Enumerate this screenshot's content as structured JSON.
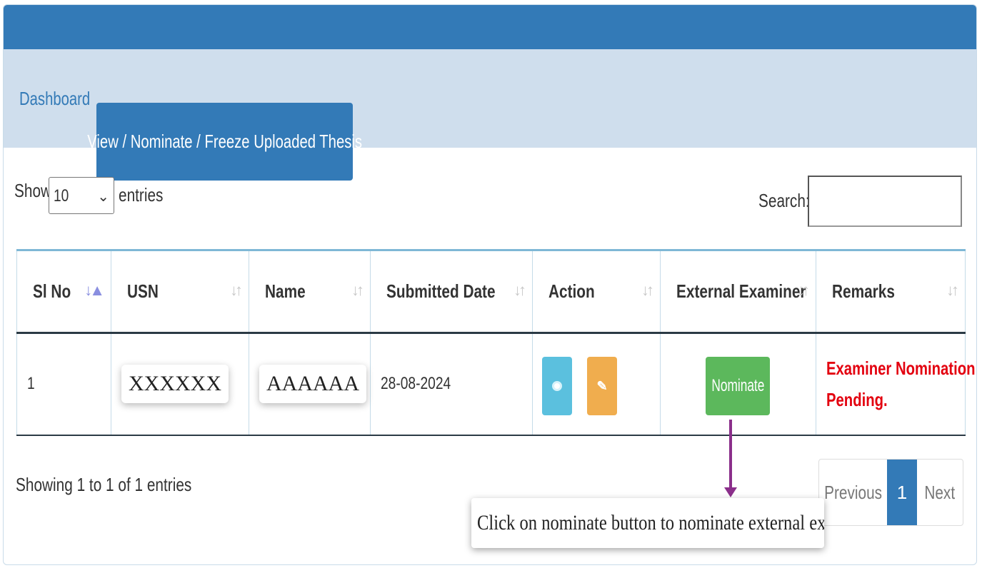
{
  "tabs": {
    "dashboard": "Dashboard",
    "active": "View / Nominate / Freeze Uploaded Thesis"
  },
  "length_menu": {
    "show_label": "Show",
    "selected": "10",
    "entries_label": "entries"
  },
  "search": {
    "label": "Search:",
    "value": ""
  },
  "table": {
    "columns": [
      "Sl No",
      "USN",
      "Name",
      "Submitted Date",
      "Action",
      "External Examiner",
      "Remarks"
    ],
    "rows": [
      {
        "sl_no": "1",
        "usn": "XXXXXX",
        "name": "AAAAAA",
        "submitted_date": "28-08-2024",
        "nominate_label": "Nominate",
        "remarks_line1": "Examiner Nomination",
        "remarks_line2": "Pending."
      }
    ]
  },
  "info": "Showing 1 to 1 of 1 entries",
  "pagination": {
    "previous": "Previous",
    "current": "1",
    "next": "Next"
  },
  "annotation": "Click on nominate button to nominate external examiner",
  "colors": {
    "primary": "#337ab7",
    "tab_bar": "#cfdeed",
    "view_button": "#5bc0de",
    "edit_button": "#f0ad4e",
    "nominate_button": "#5cb85c",
    "remarks": "#e3000f",
    "annotation_arrow": "#8b2f8b"
  },
  "icons": {
    "view": "eye-icon",
    "edit": "edit-icon",
    "sort": "sort-icon",
    "dropdown": "chevron-down-icon"
  }
}
